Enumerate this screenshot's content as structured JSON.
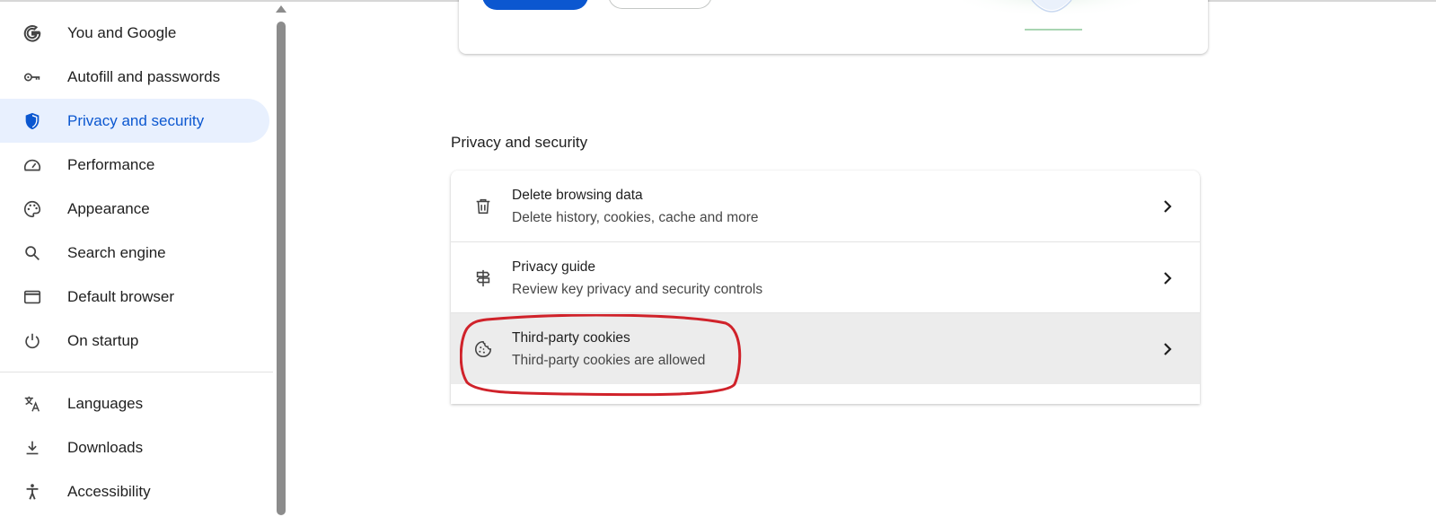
{
  "sidebar": {
    "items": [
      {
        "label": "You and Google",
        "icon": "google-g-icon",
        "active": false
      },
      {
        "label": "Autofill and passwords",
        "icon": "key-icon",
        "active": false
      },
      {
        "label": "Privacy and security",
        "icon": "shield-icon",
        "active": true
      },
      {
        "label": "Performance",
        "icon": "speedometer-icon",
        "active": false
      },
      {
        "label": "Appearance",
        "icon": "palette-icon",
        "active": false
      },
      {
        "label": "Search engine",
        "icon": "search-icon",
        "active": false
      },
      {
        "label": "Default browser",
        "icon": "browser-window-icon",
        "active": false
      },
      {
        "label": "On startup",
        "icon": "power-icon",
        "active": false
      },
      {
        "label": "Languages",
        "icon": "translate-icon",
        "active": false
      },
      {
        "label": "Downloads",
        "icon": "download-icon",
        "active": false
      },
      {
        "label": "Accessibility",
        "icon": "accessibility-icon",
        "active": false
      }
    ]
  },
  "main": {
    "section_title": "Privacy and security",
    "rows": [
      {
        "title": "Delete browsing data",
        "subtitle": "Delete history, cookies, cache and more",
        "icon": "trash-icon"
      },
      {
        "title": "Privacy guide",
        "subtitle": "Review key privacy and security controls",
        "icon": "signpost-icon"
      },
      {
        "title": "Third-party cookies",
        "subtitle": "Third-party cookies are allowed",
        "icon": "cookie-icon",
        "highlighted": true
      }
    ]
  },
  "colors": {
    "accent": "#0b57d0",
    "active_nav_bg": "#e8f0fe",
    "annotation": "#d0222a",
    "row_hover": "#ececec"
  }
}
